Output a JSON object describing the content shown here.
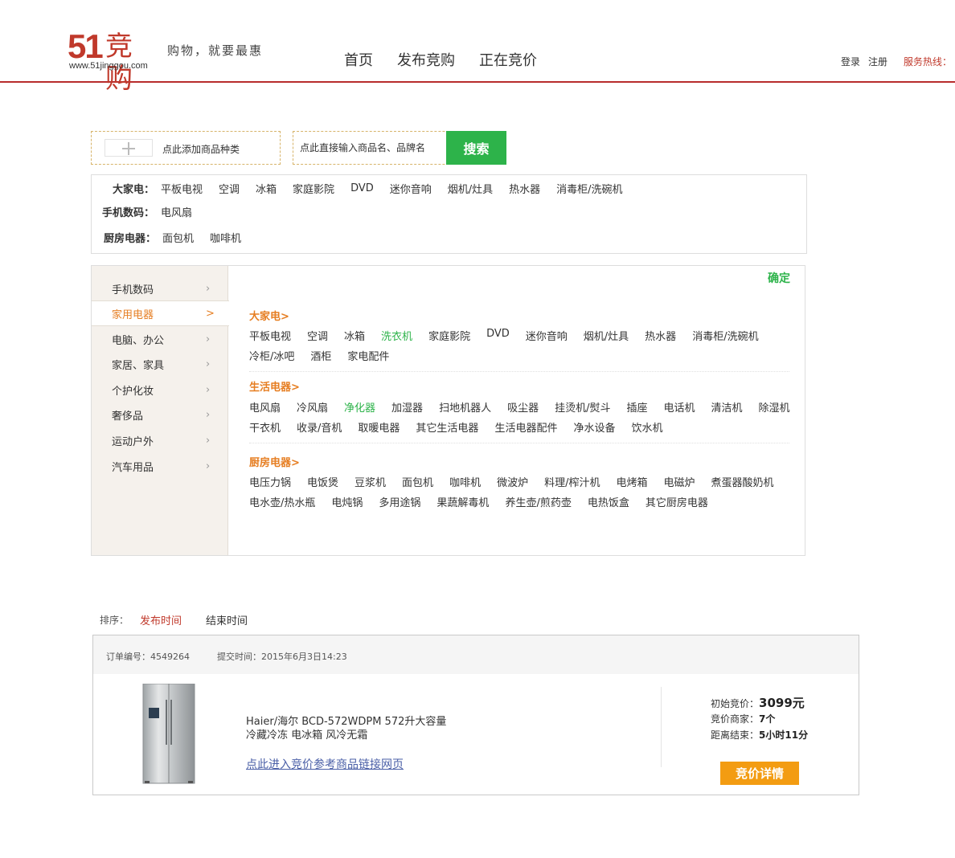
{
  "header": {
    "logo_num": "51",
    "logo_cn": "竞购",
    "logo_url": "www.51jinggou.com",
    "slogan": "购物，就要最惠",
    "nav": [
      "首页",
      "发布竞购",
      "正在竞价"
    ],
    "login": "登录",
    "register": "注册",
    "hotline": "服务热线："
  },
  "search": {
    "add_label": "点此添加商品种类",
    "placeholder": "点此直接输入商品名、品牌名",
    "button": "搜索"
  },
  "summary": {
    "rows": [
      {
        "label": "大家电：",
        "items": [
          "平板电视",
          "空调",
          "冰箱",
          "家庭影院",
          "DVD",
          "迷你音响",
          "烟机/灶具",
          "热水器",
          "消毒柜/洗碗机"
        ]
      },
      {
        "label": "手机数码：",
        "items": [
          "电风扇"
        ]
      },
      {
        "label": "厨房电器：",
        "items": [
          "面包机",
          "咖啡机"
        ]
      }
    ]
  },
  "panel": {
    "confirm": "确定",
    "sidebar": [
      "手机数码",
      "家用电器",
      "电脑、办公",
      "家居、家具",
      "个护化妆",
      "奢侈品",
      "运动户外",
      "汽车用品"
    ],
    "active_index": 1,
    "groups": [
      {
        "title": "大家电>",
        "rows": [
          [
            "平板电视",
            "空调",
            "冰箱",
            "洗衣机",
            "家庭影院",
            "DVD",
            "迷你音响",
            "烟机/灶具",
            "热水器",
            "消毒柜/洗碗机"
          ],
          [
            "冷柜/冰吧",
            "酒柜",
            "家电配件"
          ]
        ],
        "highlight": [
          "洗衣机"
        ]
      },
      {
        "title": "生活电器>",
        "rows": [
          [
            "电风扇",
            "冷风扇",
            "净化器",
            "加湿器",
            "扫地机器人",
            "吸尘器",
            "挂烫机/熨斗",
            "插座",
            "电话机",
            "清洁机",
            "除湿机"
          ],
          [
            "干衣机",
            "收录/音机",
            "取暖电器",
            "其它生活电器",
            "生活电器配件",
            "净水设备",
            "饮水机"
          ]
        ],
        "highlight": [
          "净化器"
        ]
      },
      {
        "title": "厨房电器>",
        "rows": [
          [
            "电压力锅",
            "电饭煲",
            "豆浆机",
            "面包机",
            "咖啡机",
            "微波炉",
            "料理/榨汁机",
            "电烤箱",
            "电磁炉",
            "煮蛋器酸奶机"
          ],
          [
            "电水壶/热水瓶",
            "电炖锅",
            "多用途锅",
            "果蔬解毒机",
            "养生壶/煎药壶",
            "电热饭盒",
            "其它厨房电器"
          ]
        ],
        "highlight": []
      }
    ]
  },
  "sort": {
    "label": "排序：",
    "options": [
      "发布时间",
      "结束时间"
    ],
    "active": "发布时间"
  },
  "order": {
    "number_label": "订单编号：",
    "number": "4549264",
    "time_label": "提交时间：",
    "time": "2015年6月3日14:23",
    "title_line1": "Haier/海尔 BCD-572WDPM 572升大容量",
    "title_line2": "冷藏冷冻 电冰箱 风冷无霜",
    "link": "点此进入竞价参考商品链接网页",
    "start_price_label": "初始竞价：",
    "start_price": "3099元",
    "bidders_label": "竞价商家：",
    "bidders": "7个",
    "remaining_label": "距离结束：",
    "remaining": "5小时11分",
    "detail_button": "竞价详情"
  },
  "colors": {
    "brand_red": "#c0392b",
    "green": "#2db34a",
    "orange": "#e67e22",
    "button_orange": "#f39c12"
  }
}
